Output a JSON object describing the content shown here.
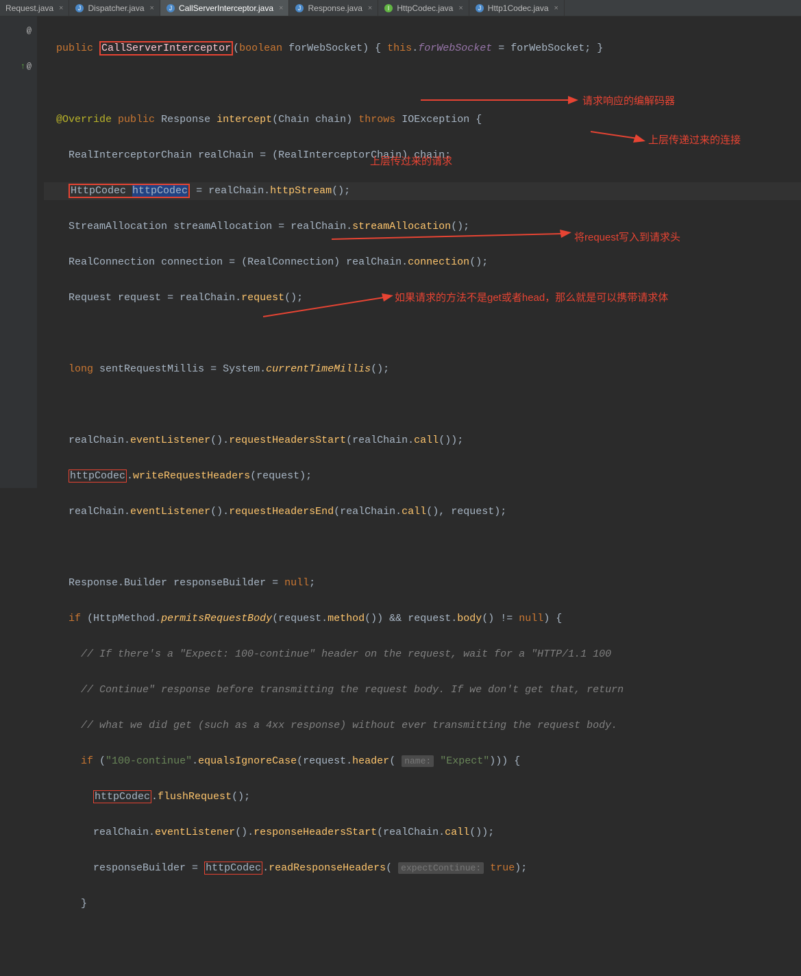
{
  "tabs": [
    {
      "name": "Request.java",
      "active": false
    },
    {
      "name": "Dispatcher.java",
      "active": false
    },
    {
      "name": "CallServerInterceptor.java",
      "active": true
    },
    {
      "name": "Response.java",
      "active": false
    },
    {
      "name": "HttpCodec.java",
      "active": false
    },
    {
      "name": "Http1Codec.java",
      "active": false
    }
  ],
  "gutter": {
    "mark1": "@",
    "mark2": "@"
  },
  "code": {
    "kw_public": "public",
    "kw_override": "@Override",
    "kw_throws": "throws",
    "kw_this": "this",
    "kw_boolean": "boolean",
    "kw_long": "long",
    "kw_null": "null",
    "kw_if": "if",
    "kw_true": "true",
    "classname": "CallServerInterceptor",
    "p_forWebSocket": "forWebSocket",
    "f_forWebSocket": "forWebSocket",
    "t_Response": "Response",
    "m_intercept": "intercept",
    "t_Chain": "Chain",
    "p_chain": "chain",
    "t_IOException": "IOException",
    "t_RealInterceptorChain": "RealInterceptorChain",
    "v_realChain": "realChain",
    "t_HttpCodec": "HttpCodec",
    "v_httpCodec": "httpCodec",
    "m_httpStream": "httpStream",
    "t_StreamAllocation": "StreamAllocation",
    "v_streamAllocation": "streamAllocation",
    "m_streamAllocation": "streamAllocation",
    "t_RealConnection": "RealConnection",
    "v_connection": "connection",
    "m_connection": "connection",
    "t_Request": "Request",
    "v_request": "request",
    "m_request": "request",
    "v_sentRequestMillis": "sentRequestMillis",
    "t_System": "System",
    "m_currentTimeMillis": "currentTimeMillis",
    "m_eventListener": "eventListener",
    "m_requestHeadersStart": "requestHeadersStart",
    "m_call": "call",
    "m_writeRequestHeaders": "writeRequestHeaders",
    "m_requestHeadersEnd": "requestHeadersEnd",
    "t_Builder": "Builder",
    "v_responseBuilder": "responseBuilder",
    "t_HttpMethod": "HttpMethod",
    "m_permitsRequestBody": "permitsRequestBody",
    "m_method": "method",
    "m_body": "body",
    "cmt1": "// If there's a \"Expect: 100-continue\" header on the request, wait for a \"HTTP/1.1 100",
    "cmt2": "// Continue\" response before transmitting the request body. If we don't get that, return",
    "cmt3": "// what we did get (such as a 4xx response) without ever transmitting the request body.",
    "s_100continue": "\"100-continue\"",
    "m_equalsIgnoreCase": "equalsIgnoreCase",
    "m_header": "header",
    "hint_name": "name:",
    "s_Expect": "\"Expect\"",
    "m_flushRequest": "flushRequest",
    "m_responseHeadersStart": "responseHeadersStart",
    "m_readResponseHeaders": "readResponseHeaders",
    "hint_expectContinue": "expectContinue:"
  },
  "annotations": {
    "a1": "请求响应的编解码器",
    "a2": "上层传递过来的连接",
    "a3": "上层传过来的请求",
    "a4": "将request写入到请求头",
    "a5": "如果请求的方法不是get或者head，那么就是可以携带请求体"
  }
}
